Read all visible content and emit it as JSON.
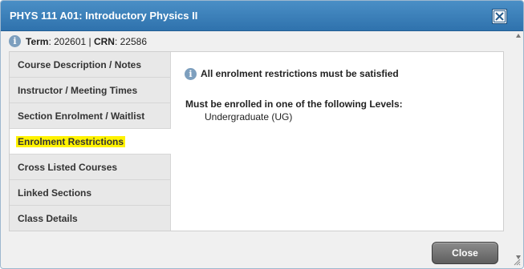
{
  "dialog": {
    "title": "PHYS 111 A01: Introductory Physics II",
    "close_icon": "close-x-icon"
  },
  "term": {
    "term_label": "Term",
    "term_value": ": 202601 | ",
    "crn_label": "CRN",
    "crn_value": ": 22586"
  },
  "sidebar": {
    "items": [
      {
        "label": "Course Description / Notes"
      },
      {
        "label": "Instructor / Meeting Times"
      },
      {
        "label": "Section Enrolment / Waitlist"
      },
      {
        "label": "Enrolment Restrictions",
        "active": true
      },
      {
        "label": "Cross Listed Courses"
      },
      {
        "label": "Linked Sections"
      },
      {
        "label": "Class Details"
      }
    ]
  },
  "content": {
    "message": "All enrolment restrictions must be satisfied",
    "levels_label": "Must be enrolled in one of the following Levels:",
    "level_value": "Undergraduate (UG)"
  },
  "footer": {
    "close_label": "Close"
  },
  "colors": {
    "titlebar": "#3a80bb",
    "highlight": "#fff200"
  }
}
